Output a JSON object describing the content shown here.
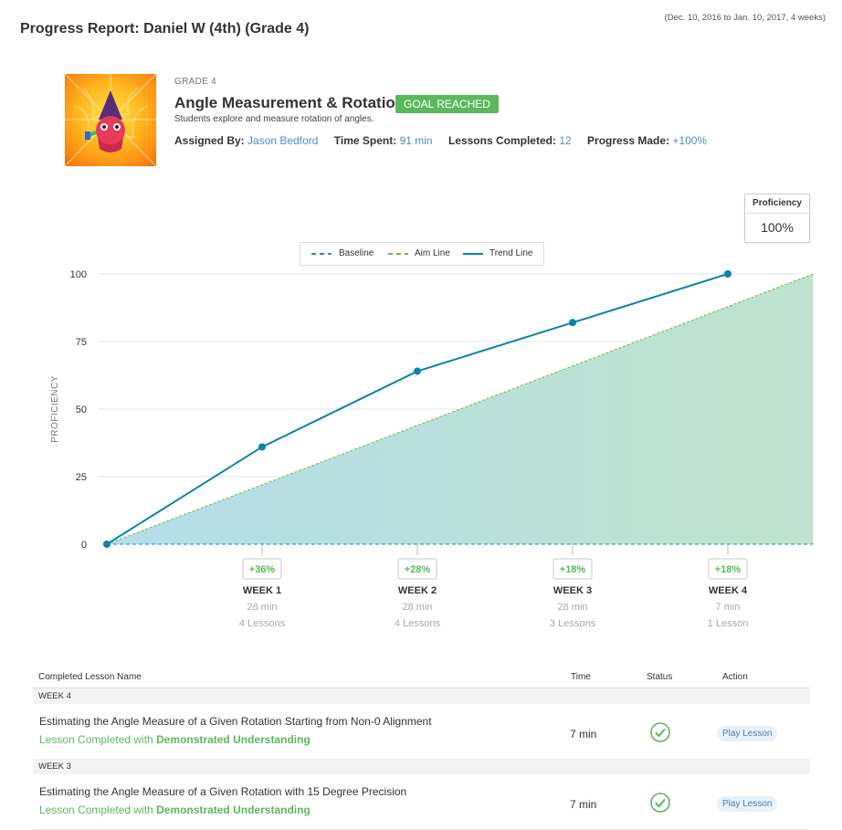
{
  "report": {
    "title": "Progress Report: Daniel W (4th) (Grade 4)",
    "date_range": "(Dec. 10, 2016 to Jan. 10, 2017, 4 weeks)"
  },
  "course": {
    "grade": "GRADE 4",
    "title": "Angle Measurement & Rotation",
    "badge": "GOAL REACHED",
    "description": "Students explore and measure rotation of angles.",
    "assigned_by_label": "Assigned By:",
    "assigned_by": "Jason Bedford",
    "time_spent_label": "Time Spent:",
    "time_spent": "91 min",
    "lessons_completed_label": "Lessons Completed:",
    "lessons_completed": "12",
    "progress_made_label": "Progress Made:",
    "progress_made": "+100%"
  },
  "proficiency_box": {
    "label": "Proficiency",
    "value": "100%"
  },
  "chart_data": {
    "type": "line",
    "ylabel": "PROFICIENCY",
    "ylim": [
      0,
      100
    ],
    "yticks": [
      "0",
      "25",
      "50",
      "75",
      "100"
    ],
    "grid": true,
    "legend_position": "top",
    "legend": [
      "Baseline",
      "Aim Line",
      "Trend Line"
    ],
    "x": [
      0,
      1,
      2,
      3,
      4,
      4.55
    ],
    "series": [
      {
        "name": "Baseline",
        "color": "#2e8bc0",
        "style": "dashed",
        "x": [
          0,
          4.55
        ],
        "values": [
          0,
          0
        ]
      },
      {
        "name": "Aim Line",
        "color": "#7ab648",
        "style": "dashed",
        "x": [
          0,
          4.55
        ],
        "values": [
          0,
          100
        ]
      },
      {
        "name": "Trend Line",
        "color": "#0a85a8",
        "style": "solid",
        "x": [
          0,
          1,
          2,
          3,
          4
        ],
        "values": [
          0,
          36,
          64,
          82,
          100
        ]
      }
    ],
    "weeks": [
      {
        "x": 1,
        "gain": "+36%",
        "label": "WEEK 1",
        "time": "28 min",
        "lessons": "4 Lessons"
      },
      {
        "x": 2,
        "gain": "+28%",
        "label": "WEEK 2",
        "time": "28 min",
        "lessons": "4 Lessons"
      },
      {
        "x": 3,
        "gain": "+18%",
        "label": "WEEK 3",
        "time": "28 min",
        "lessons": "3 Lessons"
      },
      {
        "x": 4,
        "gain": "+18%",
        "label": "WEEK 4",
        "time": "7 min",
        "lessons": "1 Lesson"
      }
    ]
  },
  "table": {
    "headers": {
      "name": "Completed Lesson Name",
      "time": "Time",
      "status": "Status",
      "action": "Action"
    },
    "groups": [
      {
        "week": "WEEK 4",
        "lessons": [
          {
            "name": "Estimating the Angle Measure of a Given Rotation Starting from Non-0 Alignment",
            "status_prefix": "Lesson Completed with ",
            "status_strong": "Demonstrated Understanding",
            "time": "7 min",
            "action": "Play Lesson"
          }
        ]
      },
      {
        "week": "WEEK 3",
        "lessons": [
          {
            "name": "Estimating the Angle Measure of a Given Rotation with 15 Degree Precision",
            "status_prefix": "Lesson Completed with ",
            "status_strong": "Demonstrated Understanding",
            "time": "7 min",
            "action": "Play Lesson"
          }
        ]
      }
    ]
  },
  "colors": {
    "accent_blue": "#4a90c2",
    "success_green": "#5cb85c",
    "trend_line": "#0a85a8"
  }
}
